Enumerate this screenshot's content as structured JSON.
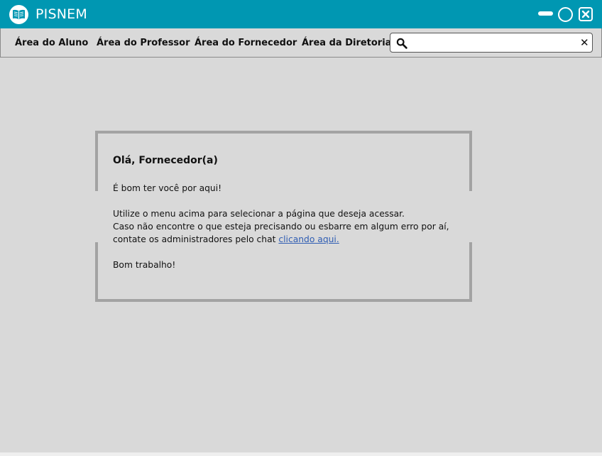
{
  "app": {
    "title": "PISNEM",
    "logo_icon": "open-book-icon",
    "accent_color": "#0097b2",
    "window_controls": [
      "minimize-icon",
      "maximize-icon",
      "close-icon"
    ]
  },
  "menu": {
    "items": [
      {
        "label": "Área do Aluno"
      },
      {
        "label": "Área do Professor"
      },
      {
        "label": "Área do Fornecedor"
      },
      {
        "label": "Área da Diretoria"
      }
    ]
  },
  "search": {
    "value": "",
    "placeholder": "",
    "icon": "search-icon",
    "clear_label": "✕"
  },
  "welcome": {
    "title": "Olá, Fornecedor(a)",
    "greeting": "É bom ter você por aqui!",
    "line1": "Utilize o menu acima para selecionar a página que deseja acessar.",
    "line2": "Caso não encontre o que esteja precisando ou esbarre em algum erro por aí,",
    "line3_prefix": "contate os administradores pelo chat ",
    "link_text": "clicando aqui.",
    "closing": "Bom trabalho!",
    "link_color": "#2f5db3"
  }
}
